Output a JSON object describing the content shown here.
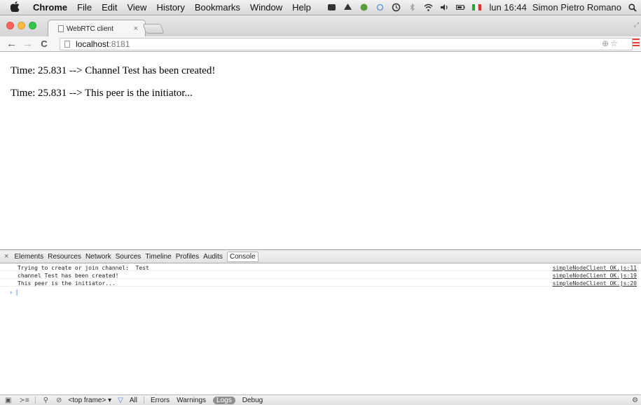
{
  "menubar": {
    "apple_icon": "apple-icon",
    "items": [
      "Chrome",
      "File",
      "Edit",
      "View",
      "History",
      "Bookmarks",
      "Window",
      "Help"
    ],
    "clock": "lun 16:44",
    "user": "Simon Pietro Romano"
  },
  "tabs": [
    {
      "title": "WebRTC client",
      "close": "×"
    }
  ],
  "toolbar": {
    "url_host": "localhost",
    "url_port": ":8181"
  },
  "page": {
    "lines": [
      "Time: 25.831 --> Channel Test has been created!",
      "Time: 25.831 --> This peer is the initiator..."
    ]
  },
  "devtools": {
    "close": "×",
    "tabs": [
      "Elements",
      "Resources",
      "Network",
      "Sources",
      "Timeline",
      "Profiles",
      "Audits",
      "Console"
    ],
    "active_tab": "Console",
    "console": [
      {
        "message": "Trying to create or join channel:  Test",
        "source": "simpleNodeClient_OK.js:11"
      },
      {
        "message": "channel Test has been created!",
        "source": "simpleNodeClient_OK.js:19"
      },
      {
        "message": "This peer is the initiator...",
        "source": "simpleNodeClient_OK.js:20"
      }
    ],
    "prompt": "›",
    "statusbar": {
      "frame_select": "<top frame> ▾",
      "levels": [
        "All",
        "Errors",
        "Warnings",
        "Logs",
        "Debug"
      ],
      "active_level": "Logs"
    }
  },
  "colors": {
    "accent_blue": "#3c79e0",
    "close_red": "#fc615d",
    "minimize_yellow": "#fdbc40",
    "maximize_green": "#34c84a"
  }
}
